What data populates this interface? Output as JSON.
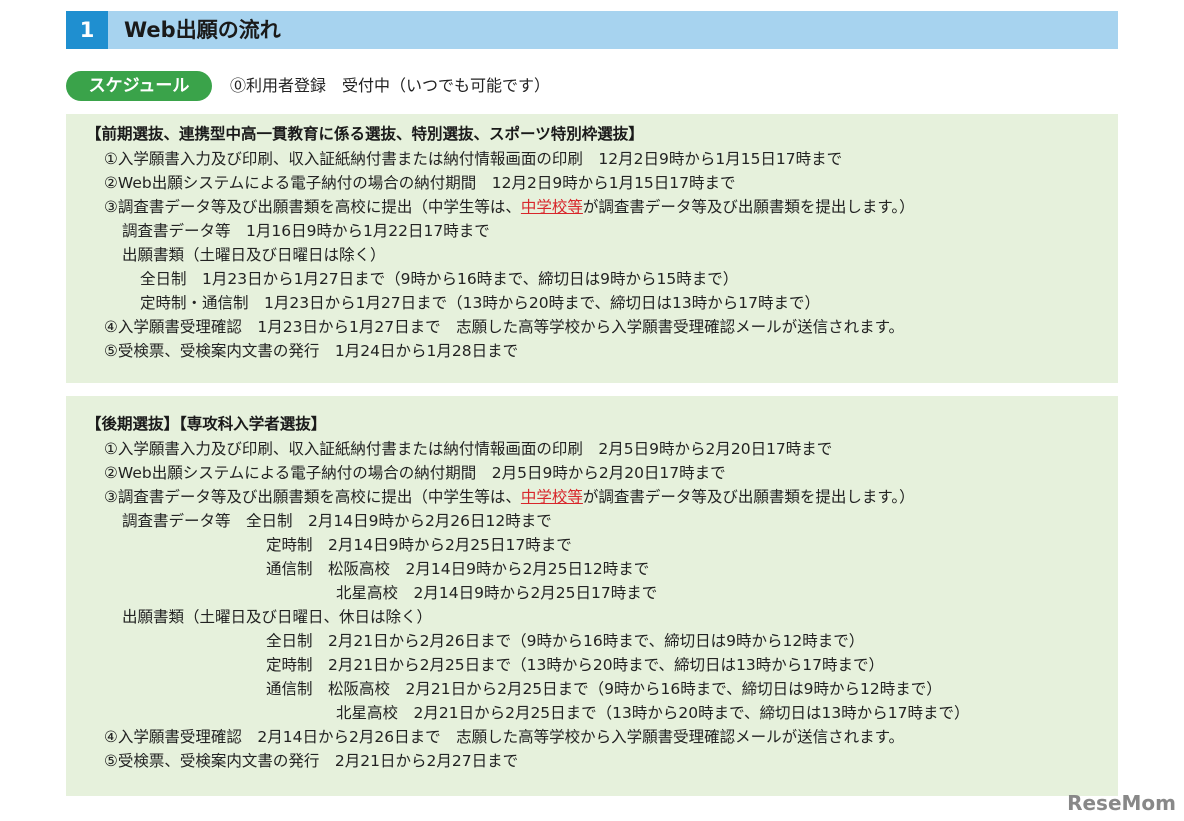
{
  "header": {
    "number": "1",
    "title": "Web出願の流れ"
  },
  "schedule": {
    "pill": "スケジュール",
    "text": "⓪利用者登録　受付中（いつでも可能です）"
  },
  "box1": {
    "title": "【前期選抜、連携型中高一貫教育に係る選抜、特別選抜、スポーツ特別枠選抜】",
    "l1": "①入学願書入力及び印刷、収入証紙納付書または納付情報画面の印刷　12月2日9時から1月15日17時まで",
    "l2": "②Web出願システムによる電子納付の場合の納付期間　12月2日9時から1月15日17時まで",
    "l3a": "③調査書データ等及び出願書類を高校に提出（中学生等は、",
    "l3red": "中学校等",
    "l3b": "が調査書データ等及び出願書類を提出します。）",
    "l4": "調査書データ等　1月16日9時から1月22日17時まで",
    "l5": "出願書類（土曜日及び日曜日は除く）",
    "l6": "全日制　1月23日から1月27日まで（9時から16時まで、締切日は9時から15時まで）",
    "l7": "定時制・通信制　1月23日から1月27日まで（13時から20時まで、締切日は13時から17時まで）",
    "l8": "④入学願書受理確認　1月23日から1月27日まで　志願した高等学校から入学願書受理確認メールが送信されます。",
    "l9": "⑤受検票、受検案内文書の発行　1月24日から1月28日まで"
  },
  "box2": {
    "title": "【後期選抜】【専攻科入学者選抜】",
    "l1": "①入学願書入力及び印刷、収入証紙納付書または納付情報画面の印刷　2月5日9時から2月20日17時まで",
    "l2": "②Web出願システムによる電子納付の場合の納付期間　2月5日9時から2月20日17時まで",
    "l3a": "③調査書データ等及び出願書類を高校に提出（中学生等は、",
    "l3red": "中学校等",
    "l3b": "が調査書データ等及び出願書類を提出します。）",
    "l4": "調査書データ等　全日制　2月14日9時から2月26日12時まで",
    "l5": "定時制　2月14日9時から2月25日17時まで",
    "l6": "通信制　松阪高校　2月14日9時から2月25日12時まで",
    "l7": "北星高校　2月14日9時から2月25日17時まで",
    "l8": "出願書類（土曜日及び日曜日、休日は除く）",
    "l9": "全日制　2月21日から2月26日まで（9時から16時まで、締切日は9時から12時まで）",
    "l10": "定時制　2月21日から2月25日まで（13時から20時まで、締切日は13時から17時まで）",
    "l11": "通信制　松阪高校　2月21日から2月25日まで（9時から16時まで、締切日は9時から12時まで）",
    "l12": "北星高校　2月21日から2月25日まで（13時から20時まで、締切日は13時から17時まで）",
    "l13": "④入学願書受理確認　2月14日から2月26日まで　志願した高等学校から入学願書受理確認メールが送信されます。",
    "l14": "⑤受検票、受検案内文書の発行　2月21日から2月27日まで"
  },
  "logo": "ReseMom"
}
